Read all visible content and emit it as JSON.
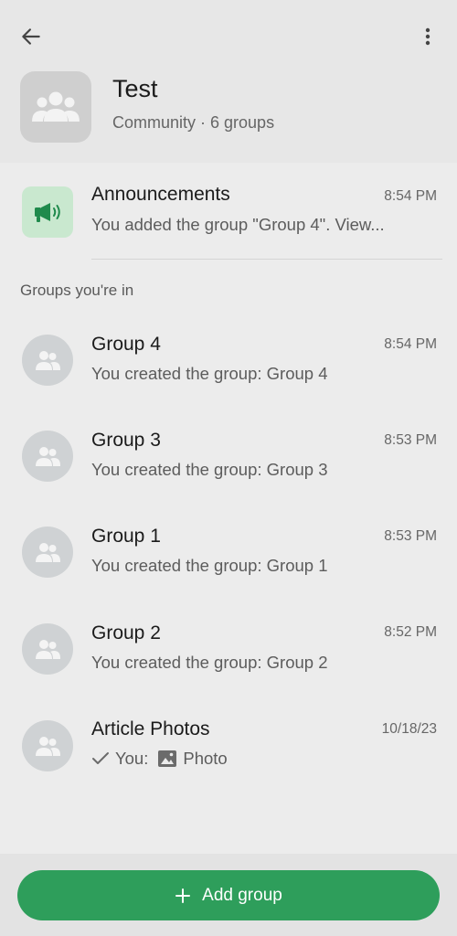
{
  "header": {
    "title": "Test",
    "subtitle": "Community · 6 groups"
  },
  "announcements": {
    "title": "Announcements",
    "subtitle": "You added the group \"Group 4\". View...",
    "time": "8:54 PM"
  },
  "section_label": "Groups you're in",
  "groups": [
    {
      "title": "Group 4",
      "subtitle": "You created the group: Group 4",
      "time": "8:54 PM"
    },
    {
      "title": "Group 3",
      "subtitle": "You created the group: Group 3",
      "time": "8:53 PM"
    },
    {
      "title": "Group 1",
      "subtitle": "You created the group: Group 1",
      "time": "8:53 PM"
    },
    {
      "title": "Group 2",
      "subtitle": "You created the group: Group 2",
      "time": "8:52 PM"
    }
  ],
  "article": {
    "title": "Article Photos",
    "sender": "You:",
    "media_label": "Photo",
    "time": "10/18/23"
  },
  "add_button": {
    "label": "Add group"
  },
  "colors": {
    "accent": "#2e9e5b",
    "announce_bg": "#c9e8cf",
    "announce_icon": "#1f8a4c"
  },
  "icons": [
    "back-arrow-icon",
    "more-vert-icon",
    "community-people-icon",
    "megaphone-icon",
    "group-people-icon",
    "check-icon",
    "image-icon",
    "plus-icon"
  ]
}
